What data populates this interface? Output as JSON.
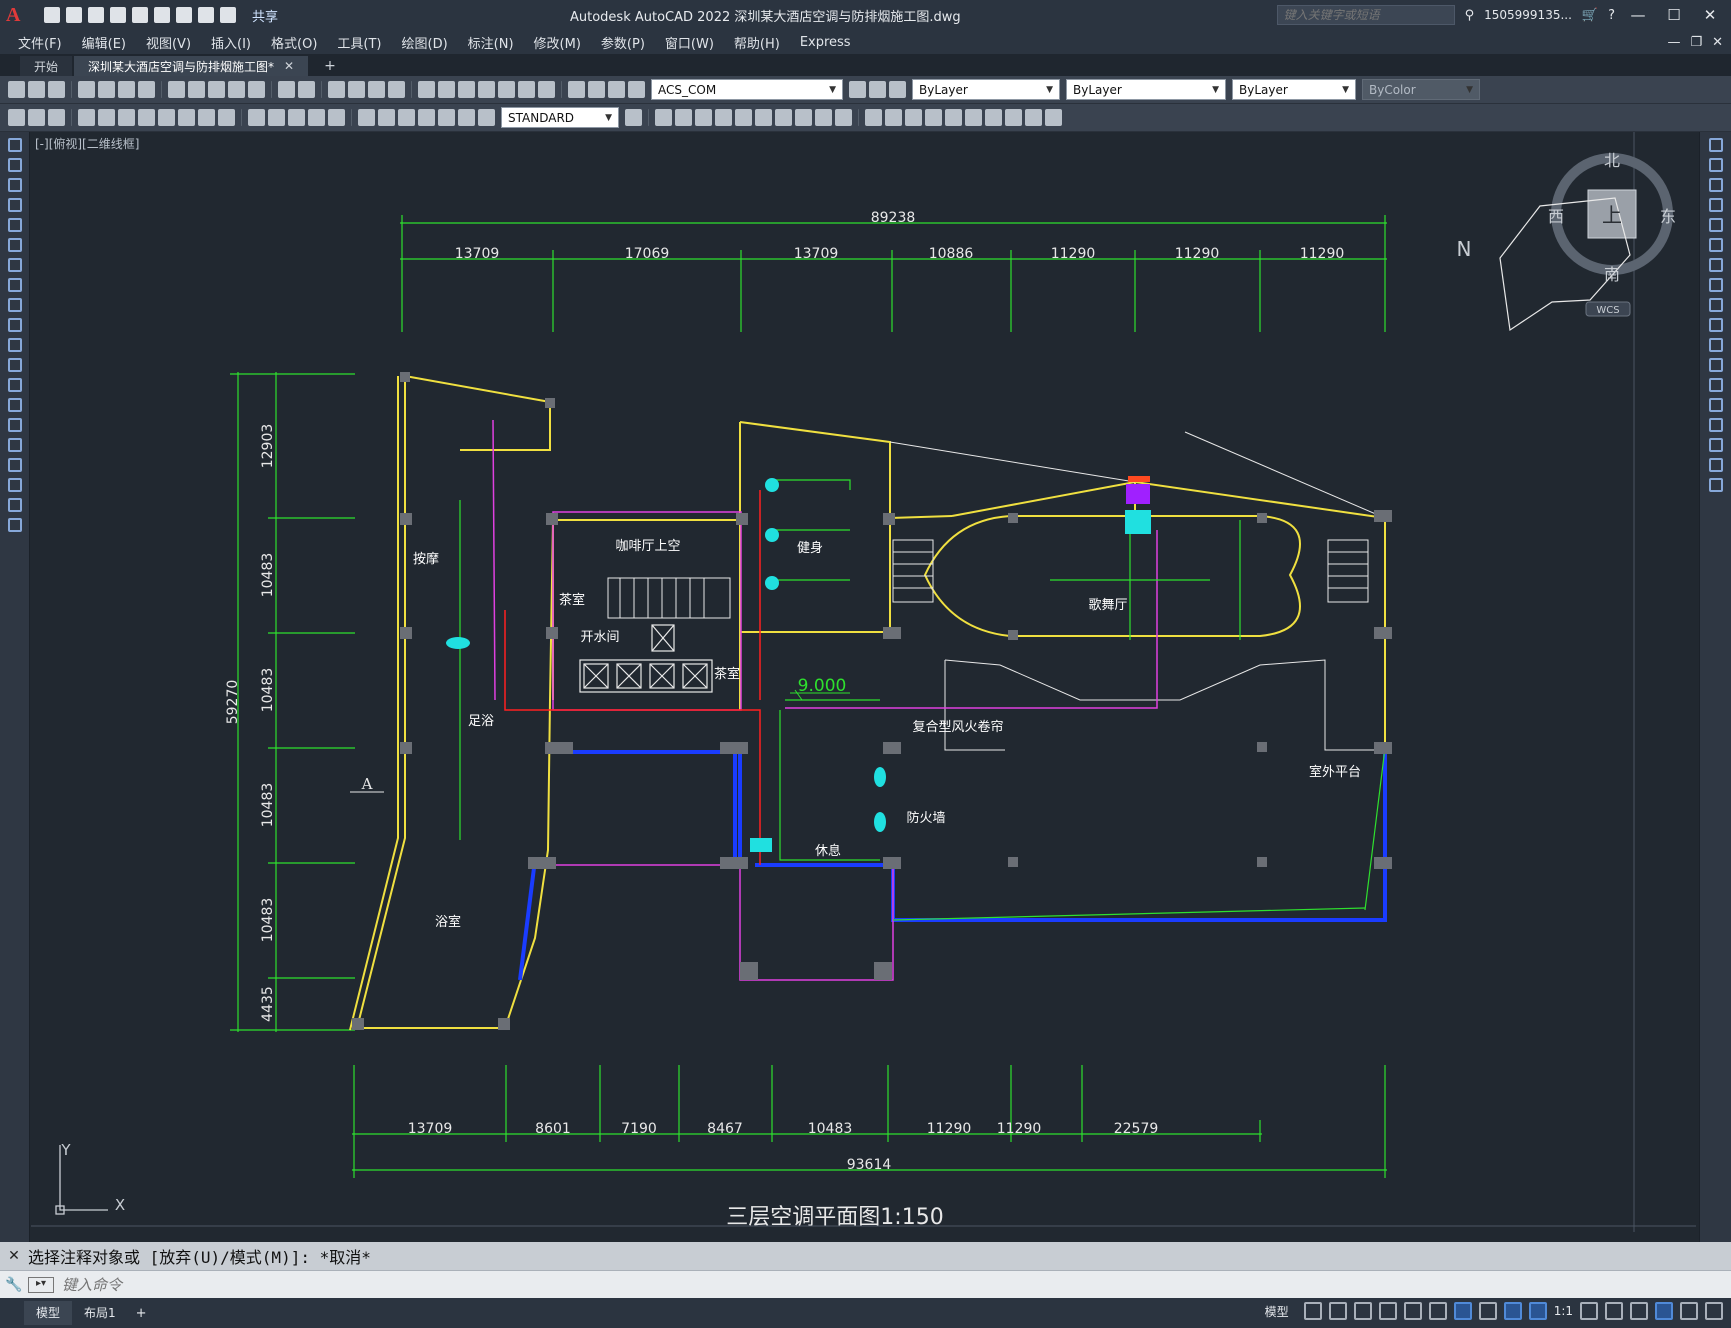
{
  "app": {
    "logo_letter": "A",
    "title": "Autodesk AutoCAD 2022    深圳某大酒店空调与防排烟施工图.dwg",
    "share_label": "共享",
    "search_placeholder": "键入关键字或短语",
    "user_label": "1505999135...",
    "window_controls": [
      "—",
      "☐",
      "✕"
    ]
  },
  "menu": [
    "文件(F)",
    "编辑(E)",
    "视图(V)",
    "插入(I)",
    "格式(O)",
    "工具(T)",
    "绘图(D)",
    "标注(N)",
    "修改(M)",
    "参数(P)",
    "窗口(W)",
    "帮助(H)",
    "Express"
  ],
  "tabs": [
    {
      "label": "开始"
    },
    {
      "label": "深圳某大酒店空调与防排烟施工图*"
    }
  ],
  "toolbar": {
    "layer_combo": "ACS_COM",
    "color_combo": "ByLayer",
    "linetype_combo": "ByLayer",
    "lineweight_combo": "ByLayer",
    "plotstyle_combo": "ByColor",
    "textstyle_combo": "STANDARD"
  },
  "viewport": {
    "label": "[-][俯视][二维线框]",
    "viewcube": {
      "north": "北",
      "south": "南",
      "east": "东",
      "west": "西",
      "top": "上",
      "wcs": "WCS",
      "n": "N"
    },
    "ucs": {
      "x": "X",
      "y": "Y"
    }
  },
  "drawing": {
    "title": "三层空调平面图1:150",
    "top_total": "89238",
    "top_dims": [
      "13709",
      "17069",
      "13709",
      "10886",
      "11290",
      "11290",
      "11290"
    ],
    "left_total": "59270",
    "left_dims": [
      "12903",
      "10483",
      "10483",
      "10483",
      "10483",
      "4435"
    ],
    "bottom_dims": [
      "13709",
      "8601",
      "7190",
      "8467",
      "10483",
      "11290",
      "11290",
      "22579"
    ],
    "bottom_total": "93614",
    "elevation": "9.000",
    "axis_label": "A",
    "rooms": [
      "咖啡厅上空",
      "健身",
      "歌舞厅",
      "按摩",
      "开水间",
      "茶室",
      "茶室",
      "足浴",
      "浴室",
      "休息",
      "室外平台",
      "复合型风火卷帘",
      "防火墙"
    ]
  },
  "command": {
    "history": "选择注释对象或 [放弃(U)/模式(M)]: *取消*",
    "placeholder": "键入命令"
  },
  "layouts": [
    "模型",
    "布局1"
  ],
  "status": {
    "model": "模型",
    "scale": "1:1"
  },
  "colors": {
    "yellow": "#f0e040",
    "green": "#2ee02e",
    "magenta": "#e040e0",
    "blue": "#1a3cff",
    "red": "#ff2020",
    "cyan": "#20e0e0",
    "white": "#e8e8e8",
    "canvas": "#212830"
  }
}
